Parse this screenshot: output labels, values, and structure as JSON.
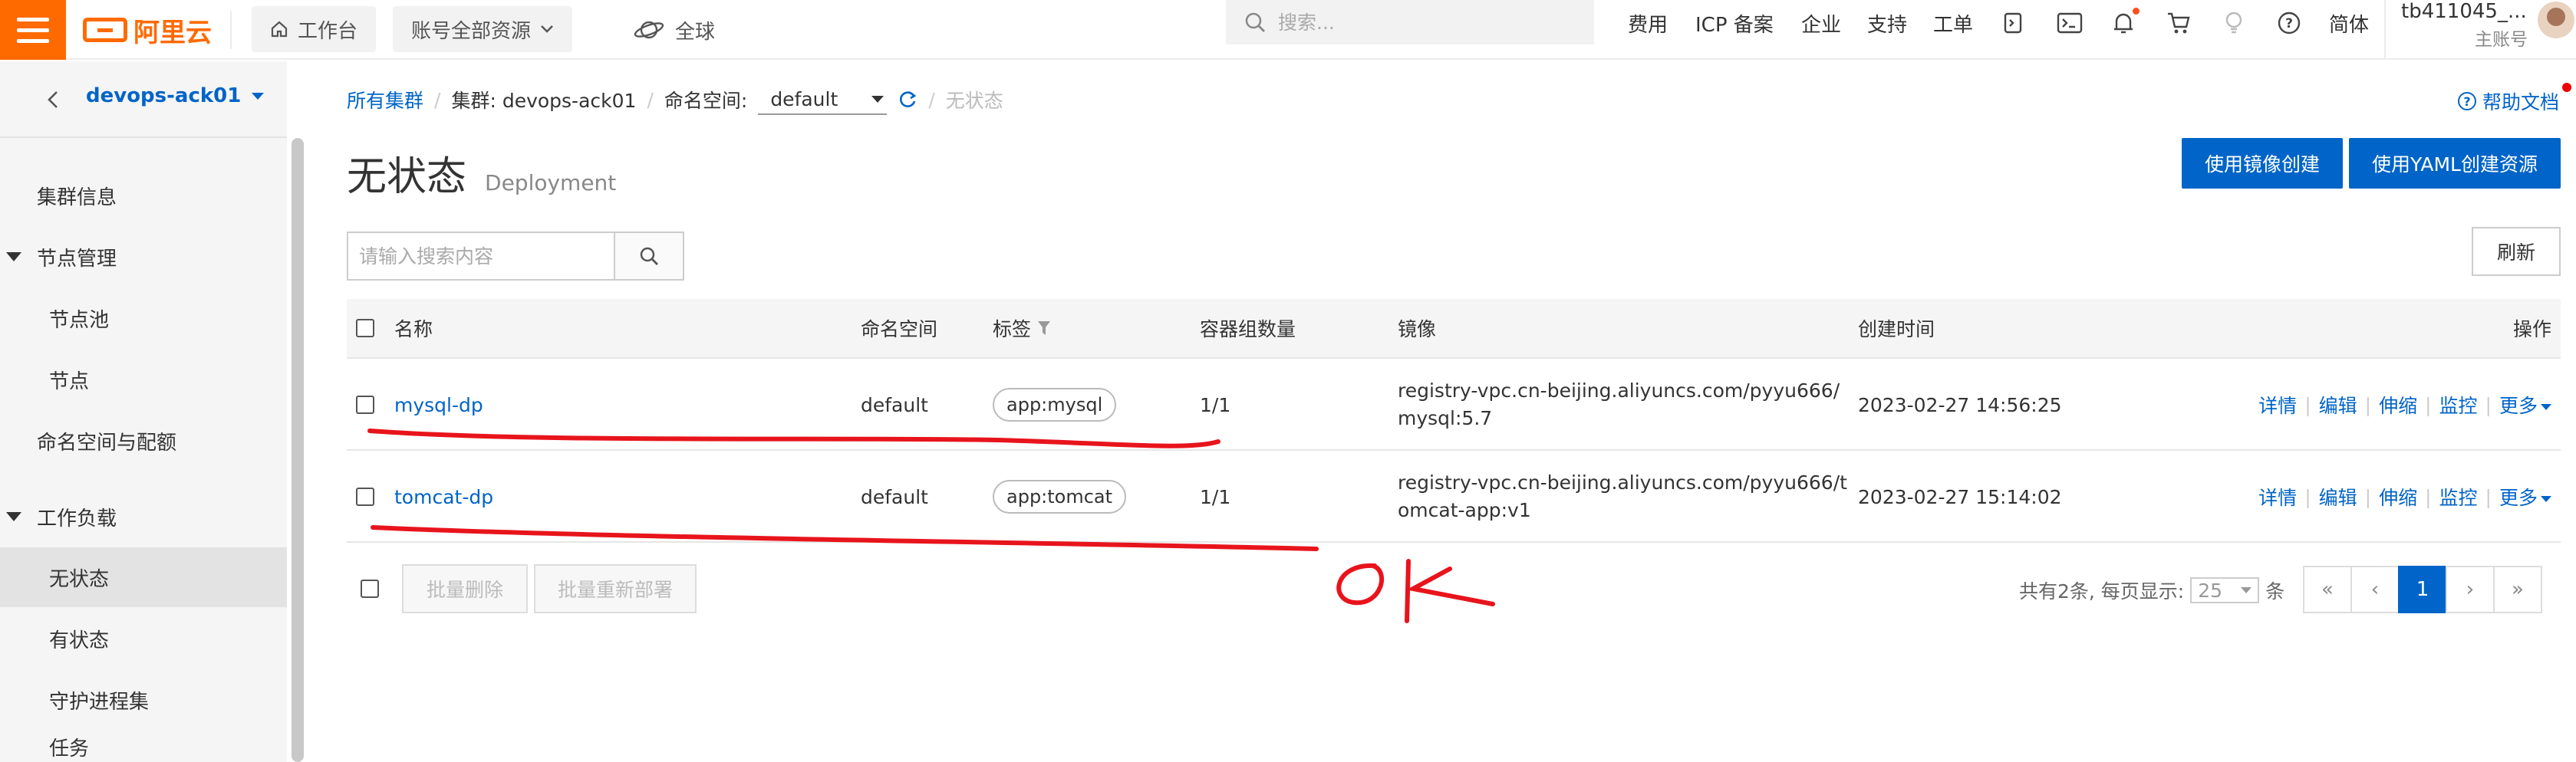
{
  "topbar": {
    "logo_text": "阿里云",
    "workbench": "工作台",
    "resource_scope": "账号全部资源",
    "region": "全球",
    "search_placeholder": "搜索...",
    "nav": [
      "费用",
      "ICP 备案",
      "企业",
      "支持",
      "工单"
    ],
    "lang": "简体",
    "user_name": "tb411045_...",
    "user_role": "主账号",
    "accent": "#ff6a00"
  },
  "sidebar": {
    "cluster_name": "devops-ack01",
    "items": [
      {
        "label": "集群信息"
      },
      {
        "label": "节点管理"
      },
      {
        "label": "节点池"
      },
      {
        "label": "节点"
      },
      {
        "label": "命名空间与配额"
      },
      {
        "label": "工作负载"
      },
      {
        "label": "无状态"
      },
      {
        "label": "有状态"
      },
      {
        "label": "守护进程集"
      },
      {
        "label": "任务"
      }
    ]
  },
  "breadcrumb": {
    "all_clusters": "所有集群",
    "cluster": "集群: devops-ack01",
    "namespace_label": "命名空间:",
    "namespace_value": "default",
    "current": "无状态"
  },
  "help": "帮助文档",
  "page": {
    "title": "无状态",
    "subtitle": "Deployment",
    "btn_image_create": "使用镜像创建",
    "btn_yaml_create": "使用YAML创建资源",
    "search_placeholder": "请输入搜索内容",
    "refresh": "刷新"
  },
  "table": {
    "columns": [
      "名称",
      "命名空间",
      "标签",
      "容器组数量",
      "镜像",
      "创建时间",
      "操作"
    ],
    "rows": [
      {
        "name": "mysql-dp",
        "namespace": "default",
        "label": "app:mysql",
        "pods": "1/1",
        "image": "registry-vpc.cn-beijing.aliyuncs.com/pyyu666/mysql:5.7",
        "created": "2023-02-27 14:56:25"
      },
      {
        "name": "tomcat-dp",
        "namespace": "default",
        "label": "app:tomcat",
        "pods": "1/1",
        "image": "registry-vpc.cn-beijing.aliyuncs.com/pyyu666/tomcat-app:v1",
        "created": "2023-02-27 15:14:02"
      }
    ],
    "ops": [
      "详情",
      "编辑",
      "伸缩",
      "监控",
      "更多"
    ]
  },
  "footer": {
    "batch_delete": "批量删除",
    "batch_redeploy": "批量重新部署",
    "total_text": "共有2条, 每页显示:",
    "page_size": "25",
    "unit": "条",
    "pages": [
      "«",
      "‹",
      "1",
      "›",
      "»"
    ]
  },
  "annotation_text": "OK",
  "annotation_color": "#e8141c"
}
